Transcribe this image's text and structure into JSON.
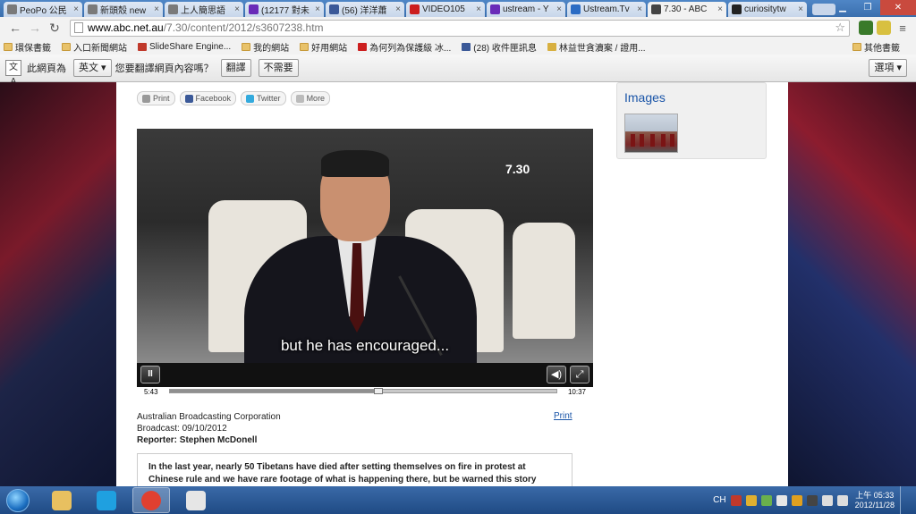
{
  "browser": {
    "tabs": [
      {
        "title": "PeoPo 公民",
        "color": "#7a7a7a"
      },
      {
        "title": "新頭殼 new",
        "color": "#7a7a7a"
      },
      {
        "title": "上人簡思語",
        "color": "#7a7a7a"
      },
      {
        "title": "(12177 對未",
        "color": "#6a2bb8"
      },
      {
        "title": "(56) 洋洋蕭",
        "color": "#3b5998"
      },
      {
        "title": "VIDEO105",
        "color": "#cc1e1e"
      },
      {
        "title": "ustream - Y",
        "color": "#6a2bb8"
      },
      {
        "title": "Ustream.Tv",
        "color": "#2b6cc4"
      },
      {
        "title": "7.30 - ABC",
        "color": "#444444"
      },
      {
        "title": "curiositytw",
        "color": "#222222"
      }
    ],
    "active_tab": 8,
    "url_host": "www.abc.net.au",
    "url_path": "/7.30/content/2012/s3607238.htm"
  },
  "bookmarks": [
    "環保書籤",
    "入口新聞網站",
    "SlideShare Engine...",
    "我的網站",
    "好用網站",
    "為何列為保護級 冰...",
    "(28) 收件匣訊息",
    "林益世貪瀆案 / 證用..."
  ],
  "bookmarks_other": "其他書籤",
  "translate": {
    "icon": "文A",
    "prefix": "此網頁為",
    "language": "英文",
    "question": "您要翻譯網頁內容嗎？",
    "translate_btn": "翻譯",
    "no_btn": "不需要",
    "options": "選項"
  },
  "share": {
    "print": "Print",
    "facebook": "Facebook",
    "twitter": "Twitter",
    "more": "More"
  },
  "video": {
    "logo": "7.30",
    "subtitle": "but he has encouraged...",
    "current_time": "5:43",
    "duration": "10:37",
    "progress": 0.54
  },
  "article": {
    "source": "Australian Broadcasting Corporation",
    "broadcast": "Broadcast: 09/10/2012",
    "reporter": "Reporter: Stephen McDonell",
    "print": "Print",
    "summary": "In the last year, nearly 50 Tibetans have died after setting themselves on fire in protest at Chinese rule and we have rare footage of what is happening there, but be warned this story"
  },
  "sidebar": {
    "images_title": "Images"
  },
  "taskbar": {
    "apps": [
      {
        "name": "explorer",
        "color": "#e8c060"
      },
      {
        "name": "skype",
        "color": "#1fa0e0"
      },
      {
        "name": "chrome",
        "color": "#e04030"
      },
      {
        "name": "paint",
        "color": "#e6e6e6"
      }
    ],
    "active_app": 2,
    "ime": "CH",
    "time": "上午 05:33",
    "date": "2012/11/28"
  }
}
